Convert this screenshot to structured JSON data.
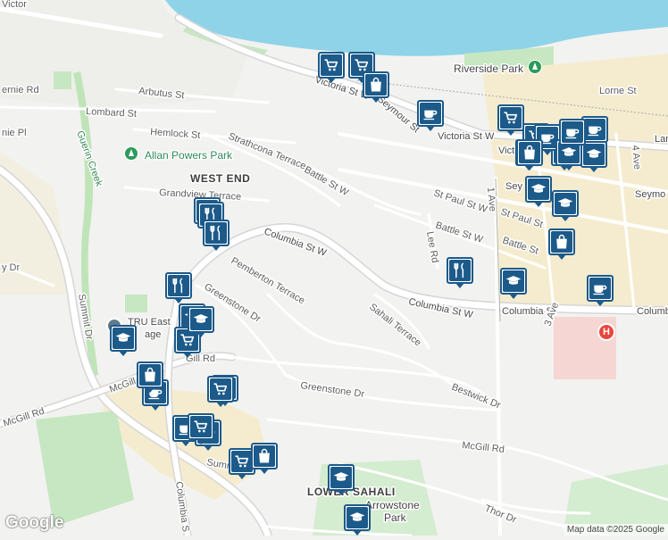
{
  "map": {
    "labels": {
      "victoria_st_w_top": "Victoria St W",
      "victoria_st_w": "Victoria St W",
      "seymour_st": "Seymour St",
      "riverside_park": "Riverside Park",
      "lorne_st": "Lorne St",
      "arbutus_st": "Arbutus St",
      "lombard_st": "Lombard St",
      "hemlock_st": "Hemlock St",
      "strathcona_terrace": "Strathcona Terrace",
      "battle_st_w": "Battle St W",
      "allan_powers_park": "Allan Powers Park",
      "west_end": "WEST END",
      "grandview_terrace": "Grandview Terrace",
      "columbia_st_w_upper": "Columbia St W",
      "pemberton_terrace": "Pemberton Terrace",
      "greenstone_dr_upper": "Greenstone Dr",
      "sahali_terrace": "Sahali Terrace",
      "columbia_st_w_lower": "Columbia St W",
      "columbia_st": "Columbia St",
      "columbia_east_edge": "Columbia",
      "st_paul_st_w": "St Paul St W",
      "st_paul_st": "St Paul St",
      "battle_st_w_2": "Battle St W",
      "battle_st": "Battle St",
      "lee_rd": "Lee Rd",
      "first_ave": "1 Ave",
      "fourth_ave": "4 Ave",
      "third_ave": "3 Ave",
      "seymour_edge": "Seymo",
      "seymour_edge_2": "Sey",
      "lan_edge": "Lan",
      "victoria_edge": "Vict",
      "ernie_rd": "ernie Rd",
      "nie_pl": "nie Pl",
      "guerin_creek": "Guerin Creek",
      "summit_dr": "Summit Dr",
      "tru_east_line1": "TRU East",
      "tru_east_line2": "age",
      "mcgill_rd_left": "McGill Rd",
      "mcgill_rd_short": "McGill",
      "gill_rd": "Gill Rd",
      "greenstone_dr_lower": "Greenstone Dr",
      "bestwick_dr": "Bestwick Dr",
      "mcgill_rd_right": "McGill Rd",
      "columbia_s_vertical": "Columbia S",
      "summ": "Sumr",
      "lower_sahali": "LOWER SAHALI",
      "arrowstone_park_line1": "Arrowstone",
      "arrowstone_park_line2": "Park",
      "thor_dr": "Thor Dr",
      "y_dr": "y Dr",
      "victor_edge": "Victor"
    },
    "attribution": "Map data ©2025 Google",
    "logo": "Google",
    "hospital_symbol": "H",
    "colors": {
      "water": "#8fd3e8",
      "marker_blue": "#1c5a8a",
      "park_green": "#c6e7c1",
      "hospital_red": "#e8453c",
      "downtown_yellow": "#f5eccf"
    }
  },
  "markers": [
    {
      "icon": "cart"
    },
    {
      "icon": "cart"
    },
    {
      "icon": "bag"
    },
    {
      "icon": "coffee"
    },
    {
      "icon": "cart"
    },
    {
      "icon": "cart"
    },
    {
      "icon": "coffee"
    },
    {
      "icon": "bag"
    },
    {
      "icon": "school"
    },
    {
      "icon": "coffee"
    },
    {
      "icon": "school"
    },
    {
      "icon": "school"
    },
    {
      "icon": "bag"
    },
    {
      "icon": "restaurant"
    },
    {
      "icon": "school"
    },
    {
      "icon": "coffee"
    },
    {
      "icon": "restaurant"
    },
    {
      "icon": "restaurant"
    },
    {
      "icon": "restaurant"
    },
    {
      "icon": "school"
    },
    {
      "icon": "school"
    },
    {
      "icon": "cart"
    },
    {
      "icon": "school"
    },
    {
      "icon": "bag"
    },
    {
      "icon": "coffee"
    },
    {
      "icon": "cart"
    },
    {
      "icon": "cart"
    },
    {
      "icon": "coffee"
    },
    {
      "icon": "coffee"
    },
    {
      "icon": "cart"
    },
    {
      "icon": "bag"
    },
    {
      "icon": "school"
    },
    {
      "icon": "school"
    }
  ]
}
